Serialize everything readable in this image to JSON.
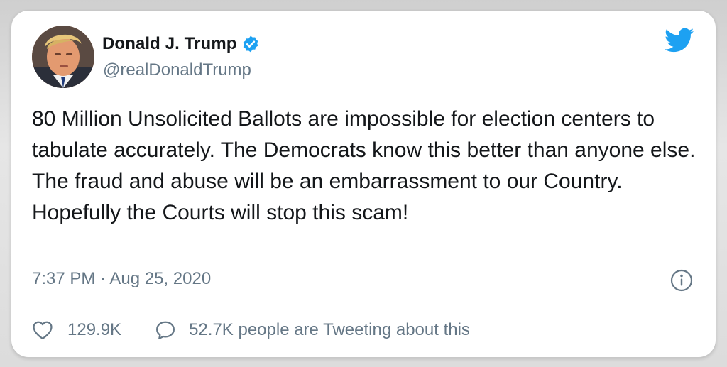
{
  "tweet": {
    "author": {
      "display_name": "Donald J. Trump",
      "handle": "@realDonaldTrump",
      "verified": true
    },
    "text": "80 Million Unsolicited Ballots are impossible for election centers to tabulate accurately. The Democrats know this better than anyone else. The fraud and abuse will be an embarrassment to our Country. Hopefully the Courts will stop this scam!",
    "timestamp": "7:37 PM · Aug 25, 2020",
    "likes": "129.9K",
    "tweeting_about": "52.7K people are Tweeting about this"
  },
  "icons": {
    "verified": "verified-badge-icon",
    "brand": "twitter-bird-icon",
    "info": "info-icon",
    "like": "heart-icon",
    "reply": "speech-bubble-icon"
  },
  "colors": {
    "brand_blue": "#1da1f2",
    "text_primary": "#14171a",
    "text_secondary": "#657786",
    "divider": "#e1e8ed"
  }
}
